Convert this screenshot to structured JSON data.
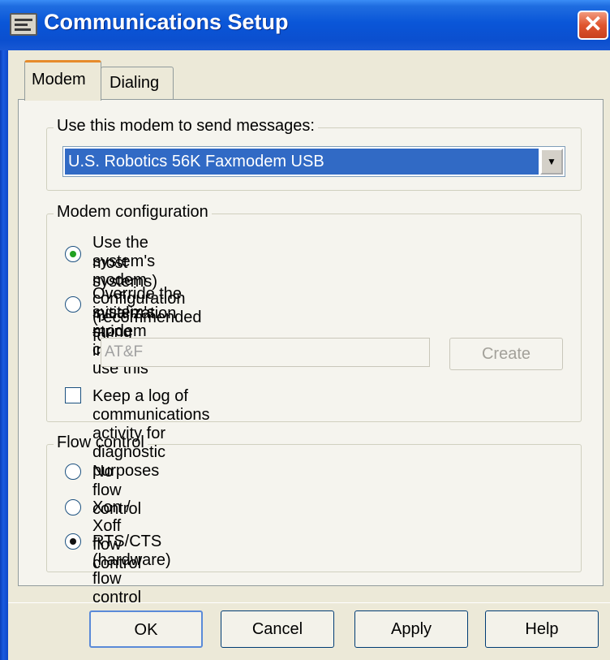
{
  "window": {
    "title": "Communications Setup",
    "close_glyph": "✕",
    "icon": "modem-icon"
  },
  "tabs": [
    {
      "label": "Modem",
      "selected": true
    },
    {
      "label": "Dialing",
      "selected": false
    }
  ],
  "modem_group": {
    "title": "Use this modem to send messages:",
    "selected_modem": "U.S. Robotics 56K Faxmodem USB",
    "arrow_glyph": "▼"
  },
  "config_group": {
    "title": "Modem configuration",
    "option_system_line1": "Use the system's modem configuration (recommended for",
    "option_system_line2": "most systems)",
    "option_override_line1": "Override the system's modem configuration, use this",
    "option_override_line2": "initialization string instead:",
    "init_string": "AT&F",
    "create_label": "Create",
    "log_label": "Keep a log of communications activity for diagnostic purposes",
    "log_checked": false,
    "selected_option": "system"
  },
  "flow_group": {
    "title": "Flow control",
    "options": [
      "No flow control",
      "Xon / Xoff flow control",
      "RTS/CTS (hardware) flow control"
    ],
    "selected_index": 2
  },
  "buttons": {
    "ok": "OK",
    "cancel": "Cancel",
    "apply": "Apply",
    "help": "Help"
  },
  "colors": {
    "titlebar": "#0b4fcf",
    "selection": "#316ac5",
    "close": "#e0552f",
    "active_tab_accent": "#e68b2c"
  }
}
